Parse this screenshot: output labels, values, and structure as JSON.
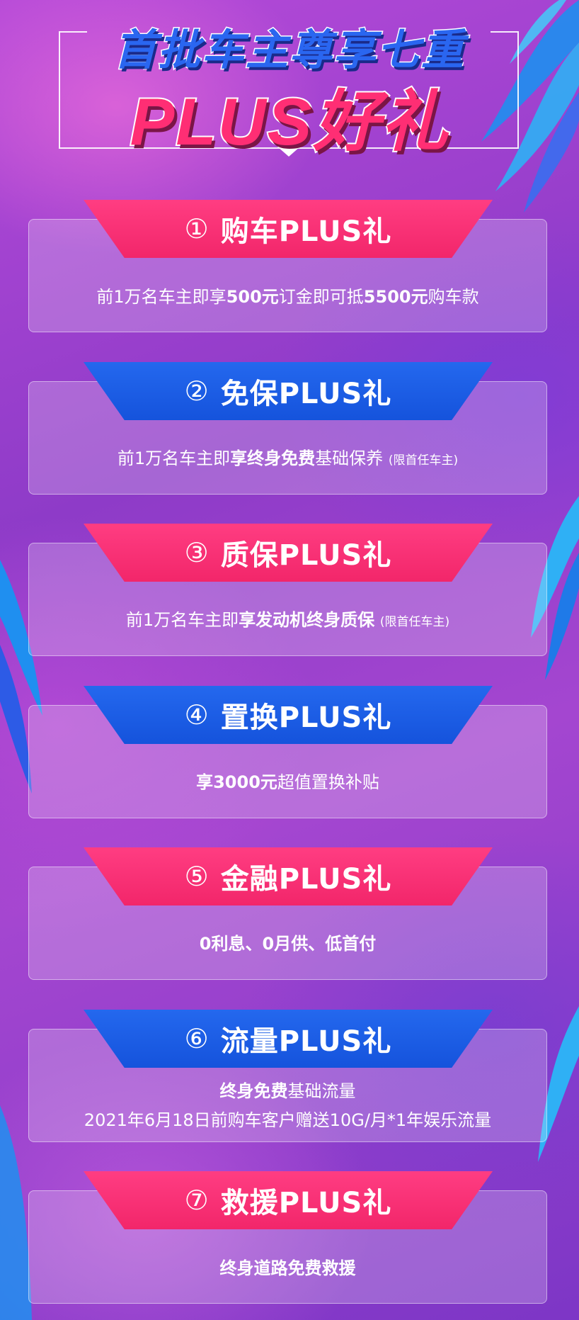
{
  "header": {
    "title_line1": "首批车主尊享七重",
    "title_line2": "PLUS好礼"
  },
  "colors": {
    "pink": "#f2266a",
    "blue": "#1553dc",
    "title_blue": "#2a66f0",
    "title_pink": "#ff2e74"
  },
  "gifts": [
    {
      "num": "①",
      "title": "购车PLUS礼",
      "d1": "前1万名车主即享",
      "d1b": "500元",
      "d2": "订金即可抵",
      "d2b": "5500元",
      "d3": "购车款"
    },
    {
      "num": "②",
      "title": "免保PLUS礼",
      "d1": "前1万名车主即",
      "d1b": "享终身免费",
      "d2": "基础保养",
      "note": "(限首任车主)"
    },
    {
      "num": "③",
      "title": "质保PLUS礼",
      "d1": "前1万名车主即",
      "d1b": "享发动机终身质保",
      "note": "(限首任车主)"
    },
    {
      "num": "④",
      "title": "置换PLUS礼",
      "d1b": "享3000元",
      "d2": "超值置换补贴"
    },
    {
      "num": "⑤",
      "title": "金融PLUS礼",
      "d1b": "0利息、0月供、低首付"
    },
    {
      "num": "⑥",
      "title": "流量PLUS礼",
      "d1b": "终身免费",
      "d2": "基础流量",
      "line2": "2021年6月18日前购车客户赠送10G/月*1年娱乐流量"
    },
    {
      "num": "⑦",
      "title": "救援PLUS礼",
      "d1b": "终身道路免费救援"
    }
  ]
}
